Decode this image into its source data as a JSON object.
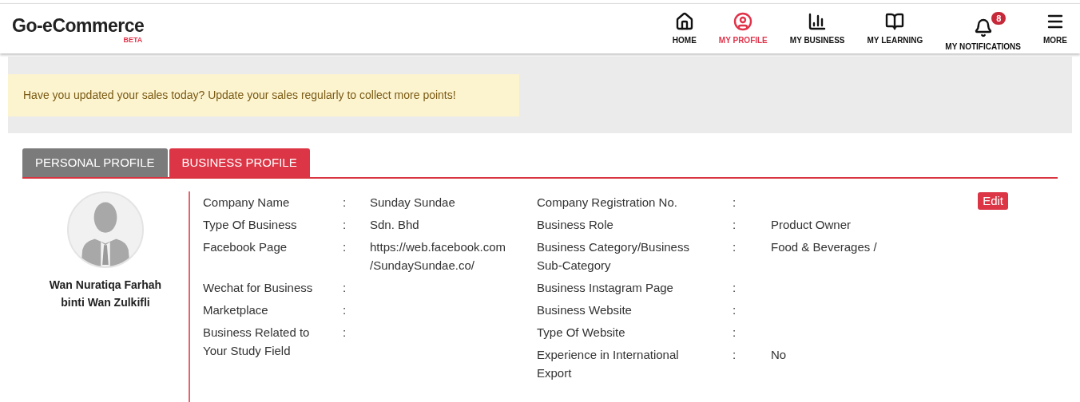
{
  "logo": {
    "title": "Go-eCommerce",
    "badge": "BETA"
  },
  "nav": [
    {
      "kind": "home",
      "label": "HOME",
      "selected": false
    },
    {
      "kind": "profile",
      "label": "MY PROFILE",
      "selected": true
    },
    {
      "kind": "business",
      "label": "MY BUSINESS",
      "selected": false
    },
    {
      "kind": "learning",
      "label": "MY LEARNING",
      "selected": false
    },
    {
      "kind": "notifications",
      "label": "MY NOTIFICATIONS",
      "selected": false,
      "count": "8"
    },
    {
      "kind": "more",
      "label": "MORE",
      "selected": false
    }
  ],
  "banner": "Have you updated your sales today? Update your sales regularly to collect more points!",
  "tabs": [
    {
      "label": "PERSONAL PROFILE",
      "selected": false
    },
    {
      "label": "BUSINESS PROFILE",
      "selected": true
    }
  ],
  "profile": {
    "name": "Wan Nuratiqa Farhah binti Wan Zulkifli"
  },
  "edit_button": "Edit",
  "fields_left": [
    {
      "label": "Company Name",
      "colon": ":",
      "value": "Sunday Sundae"
    },
    {
      "label": "Type Of Business",
      "colon": ":",
      "value": "Sdn. Bhd"
    },
    {
      "label": "Facebook Page",
      "colon": ":",
      "value": "https://web.facebook.com /SundaySundae.co/"
    },
    {
      "label": "Wechat for Business",
      "colon": ":"
    },
    {
      "label": "Marketplace",
      "colon": ":"
    },
    {
      "label": "Business Related to Your Study Field",
      "colon": ":"
    }
  ],
  "fields_right": [
    {
      "label": "Company Registration No.",
      "colon": ":"
    },
    {
      "label": "Business Role",
      "colon": ":",
      "value": "Product Owner"
    },
    {
      "label": "Business Category/Business Sub-Category",
      "colon": ":",
      "value": "Food & Beverages /"
    },
    {
      "label": "Business Instagram Page",
      "colon": ":"
    },
    {
      "label": "Business Website",
      "colon": ":"
    },
    {
      "label": "Type Of Website",
      "colon": ":"
    },
    {
      "label": "Experience in International Export",
      "colon": ":",
      "value": "No"
    }
  ]
}
